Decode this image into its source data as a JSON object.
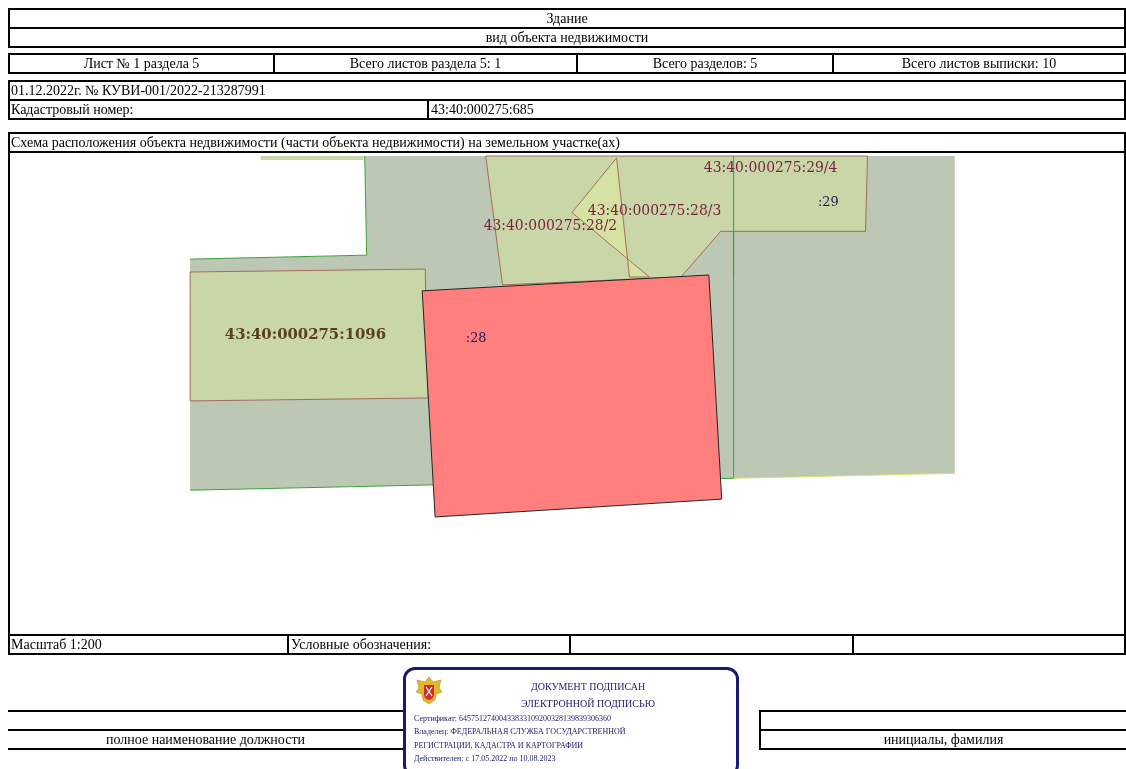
{
  "header": {
    "title": "Здание",
    "subtitle": "вид объекта недвижимости"
  },
  "sheet_info": [
    "Лист № 1 раздела 5",
    "Всего листов раздела 5: 1",
    "Всего разделов: 5",
    "Всего листов выписки: 10"
  ],
  "statement": {
    "number": "01.12.2022г. № КУВИ-001/2022-213287991",
    "cadastral_label": "Кадастровый номер:",
    "cadastral_value": "43:40:000275:685"
  },
  "scheme": {
    "title": "Схема расположения объекта недвижимости (части объекта недвижимости) на земельном участке(ах)",
    "map_labels": [
      {
        "text": "43:40:000275:29/4",
        "kind": "parcel"
      },
      {
        "text": ":29",
        "kind": "number"
      },
      {
        "text": "43:40:000275:28/3",
        "kind": "parcel"
      },
      {
        "text": "43:40:000275:28/2",
        "kind": "parcel"
      },
      {
        "text": "43:40:000275:1096",
        "kind": "bold"
      },
      {
        "text": ":28",
        "kind": "number"
      }
    ]
  },
  "footer": {
    "scale": "Масштаб 1:200",
    "legend": "Условные обозначения:"
  },
  "signature": {
    "position": "полное наименование должности",
    "name": "инициалы, фамилия",
    "stamp": {
      "title_lines": [
        "ДОКУМЕНТ ПОДПИСАН",
        "ЭЛЕКТРОННОЙ ПОДПИСЬЮ"
      ],
      "certificate": "Сертификат: 64575127400433833109200328139839306360",
      "owner_lines": [
        "Владелец: ФЕДЕРАЛЬНАЯ СЛУЖБА ГОСУДАРСТВЕННОЙ",
        "РЕГИСТРАЦИИ, КАДАСТРА И КАРТОГРАФИИ"
      ],
      "valid": "Действителен: с 17.05.2022 по 10.08.2023"
    }
  }
}
